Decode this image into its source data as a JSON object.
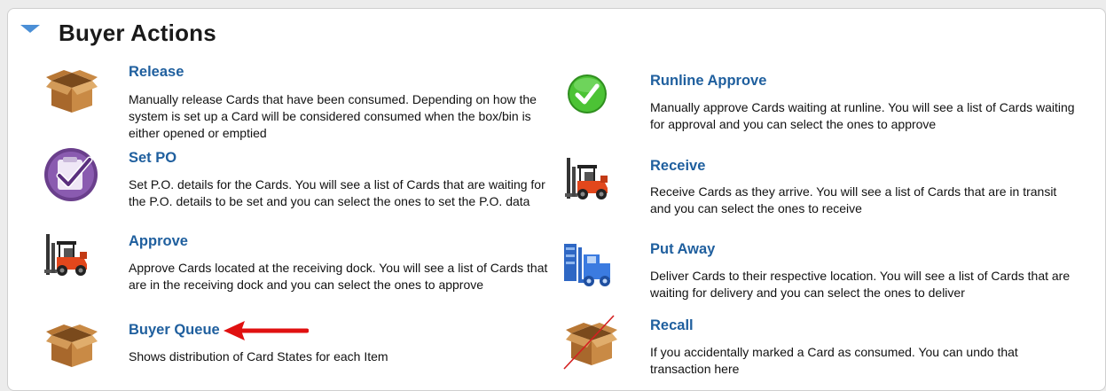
{
  "header": {
    "title": "Buyer Actions"
  },
  "actions": {
    "release": {
      "title": "Release",
      "description": "Manually release Cards that have been consumed. Depending on how the system is set up a Card will be considered consumed when the box/bin is either opened or emptied",
      "icon": "cardboard-box-icon"
    },
    "set_po": {
      "title": "Set PO",
      "description": "Set P.O. details for the Cards. You will see a list of Cards that are waiting for the P.O. details to be set and you can select the ones to set the P.O. data",
      "icon": "checklist-icon"
    },
    "approve": {
      "title": "Approve",
      "description": "Approve Cards located at the receiving dock. You will see a list of Cards that are in the receiving dock and you can select the ones to approve",
      "icon": "forklift-icon"
    },
    "buyer_queue": {
      "title": "Buyer Queue",
      "description": "Shows distribution of Card States for each Item",
      "icon": "cardboard-box-icon"
    },
    "runline_approve": {
      "title": "Runline Approve",
      "description": "Manually approve Cards waiting at runline. You will see a list of Cards waiting for approval and you can select the ones to approve",
      "icon": "green-check-icon"
    },
    "receive": {
      "title": "Receive",
      "description": "Receive Cards as they arrive. You will see a list of Cards that are in transit and you can select the ones to receive",
      "icon": "forklift-icon"
    },
    "put_away": {
      "title": "Put Away",
      "description": "Deliver Cards to their respective location. You will see a list of Cards that are waiting for delivery and you can select the ones to deliver",
      "icon": "blue-forklift-icon"
    },
    "recall": {
      "title": "Recall",
      "description": "If you accidentally marked a Card as consumed. You can undo that transaction here",
      "icon": "crossed-box-icon"
    }
  },
  "annotation": {
    "icon": "red-arrow-icon",
    "color": "#e01010"
  },
  "colors": {
    "link": "#1f5f9e",
    "toggle": "#4b8fd6"
  }
}
